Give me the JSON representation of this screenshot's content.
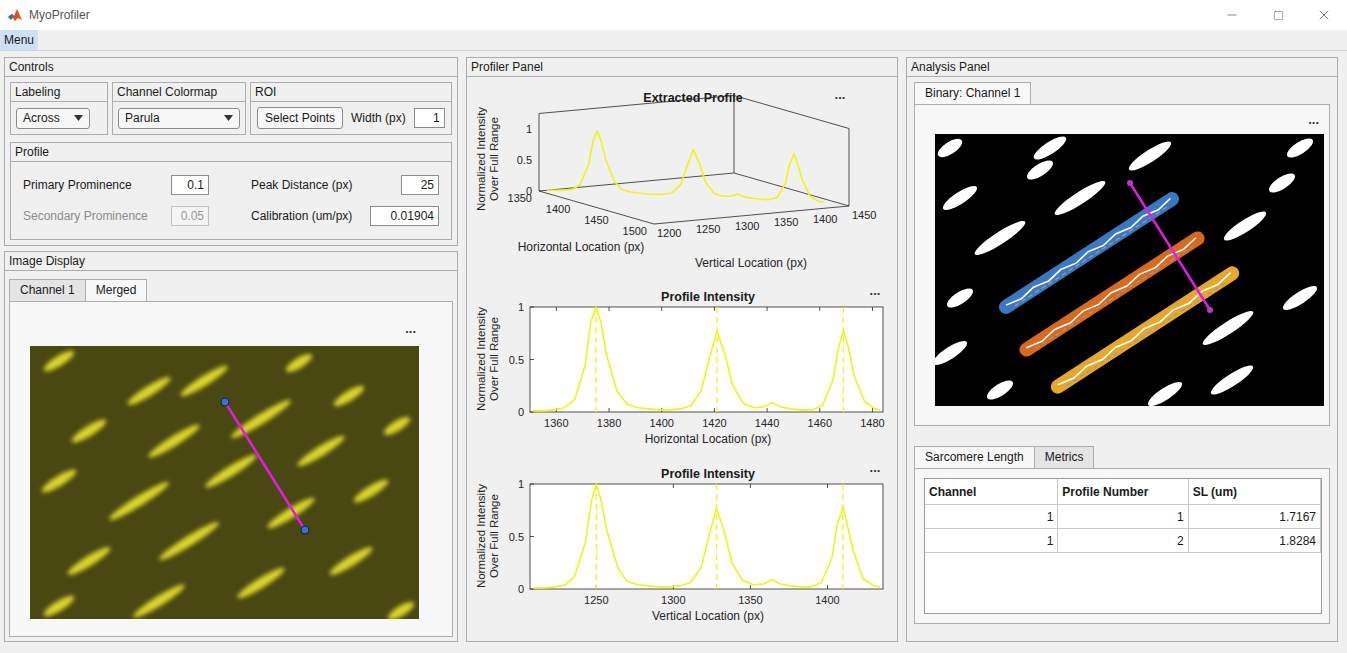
{
  "window": {
    "title": "MyoProfiler"
  },
  "menu": [
    {
      "label": "Menu",
      "selected": true
    }
  ],
  "controls": {
    "title": "Controls",
    "labeling": {
      "title": "Labeling",
      "value": "Across"
    },
    "colormap": {
      "title": "Channel Colormap",
      "value": "Parula"
    },
    "roi": {
      "title": "ROI",
      "button": "Select Points",
      "width_label": "Width (px)",
      "width_value": "1"
    },
    "profile": {
      "title": "Profile",
      "fields": [
        {
          "label": "Primary Prominence",
          "value": "0.1",
          "disabled": false
        },
        {
          "label": "Secondary Prominence",
          "value": "0.05",
          "disabled": true
        },
        {
          "label": "Peak Distance (px)",
          "value": "25",
          "disabled": false
        },
        {
          "label": "Calibration (um/px)",
          "value": "0.01904",
          "disabled": false
        }
      ]
    }
  },
  "image_display": {
    "title": "Image Display",
    "tabs": [
      {
        "label": "Channel 1",
        "selected": false
      },
      {
        "label": "Merged",
        "selected": true
      }
    ],
    "more": "..."
  },
  "profiler_panel": {
    "title": "Profiler Panel",
    "profile": {
      "horizontal": [
        1351,
        1355,
        1359,
        1363,
        1367,
        1371,
        1373,
        1375,
        1377,
        1379,
        1383,
        1387,
        1391,
        1395,
        1399,
        1403,
        1407,
        1411,
        1415,
        1418,
        1421,
        1424,
        1427,
        1431,
        1435,
        1439,
        1442,
        1445,
        1449,
        1453,
        1457,
        1461,
        1465,
        1467,
        1469,
        1471,
        1473,
        1477,
        1481,
        1483
      ],
      "vertical": [
        1209,
        1216,
        1223,
        1230,
        1236,
        1243,
        1247,
        1250,
        1253,
        1257,
        1264,
        1270,
        1277,
        1284,
        1291,
        1298,
        1304,
        1311,
        1318,
        1323,
        1328,
        1333,
        1338,
        1345,
        1352,
        1359,
        1364,
        1369,
        1376,
        1383,
        1389,
        1396,
        1403,
        1406,
        1410,
        1413,
        1417,
        1423,
        1430,
        1434
      ],
      "intensity": [
        0.01,
        0.01,
        0.02,
        0.04,
        0.12,
        0.45,
        0.85,
        1.0,
        0.85,
        0.55,
        0.2,
        0.07,
        0.04,
        0.03,
        0.02,
        0.02,
        0.03,
        0.06,
        0.2,
        0.5,
        0.77,
        0.55,
        0.25,
        0.08,
        0.04,
        0.05,
        0.09,
        0.05,
        0.03,
        0.02,
        0.02,
        0.06,
        0.3,
        0.6,
        0.78,
        0.6,
        0.35,
        0.1,
        0.03,
        0.02
      ]
    },
    "extracted": {
      "title": "Extracted Profile",
      "more": "...",
      "y_label": [
        "Normalized Intensity",
        "Over Full Range"
      ],
      "horizontal_label": "Horizontal Location (px)",
      "vertical_label": "Vertical Location (px)",
      "intensity_ticks": [
        "0",
        "0.5",
        "1"
      ],
      "horizontal_ticks": [
        "1350",
        "1400",
        "1450",
        "1500"
      ],
      "vertical_ticks": [
        "1200",
        "1250",
        "1300",
        "1350",
        "1400",
        "1450"
      ]
    },
    "charts": [
      {
        "title": "Profile Intensity",
        "more": "...",
        "axis": "horizontal",
        "y_label": [
          "Normalized Intensity",
          "Over Full Range"
        ],
        "x_label": "Horizontal Location (px)",
        "x_ticks": [
          "1360",
          "1380",
          "1400",
          "1420",
          "1440",
          "1460",
          "1480"
        ],
        "y_ticks": [
          "0",
          "0.5",
          "1"
        ],
        "x_limits": [
          1350,
          1484
        ],
        "peaks": [
          1375,
          1421,
          1469
        ]
      },
      {
        "title": "Profile Intensity",
        "more": "...",
        "axis": "vertical",
        "y_label": [
          "Normalized Intensity",
          "Over Full Range"
        ],
        "x_label": "Vertical Location (px)",
        "x_ticks": [
          "1250",
          "1300",
          "1350",
          "1400"
        ],
        "y_ticks": [
          "0",
          "0.5",
          "1"
        ],
        "x_limits": [
          1207,
          1436
        ],
        "peaks": [
          1250,
          1328,
          1410
        ]
      }
    ]
  },
  "analysis_panel": {
    "title": "Analysis Panel",
    "image_tabs": [
      {
        "label": "Binary: Channel 1",
        "selected": true
      }
    ],
    "more": "...",
    "bands": [
      {
        "color": "#3b78c4"
      },
      {
        "color": "#d9691c"
      },
      {
        "color": "#e6a82a"
      }
    ],
    "result_tabs": [
      {
        "label": "Sarcomere Length",
        "selected": true
      },
      {
        "label": "Metrics",
        "selected": false
      }
    ],
    "table": {
      "columns": [
        "Channel",
        "Profile Number",
        "SL (um)"
      ],
      "rows": [
        [
          "1",
          "1",
          "1.7167"
        ],
        [
          "1",
          "2",
          "1.8284"
        ]
      ]
    }
  }
}
